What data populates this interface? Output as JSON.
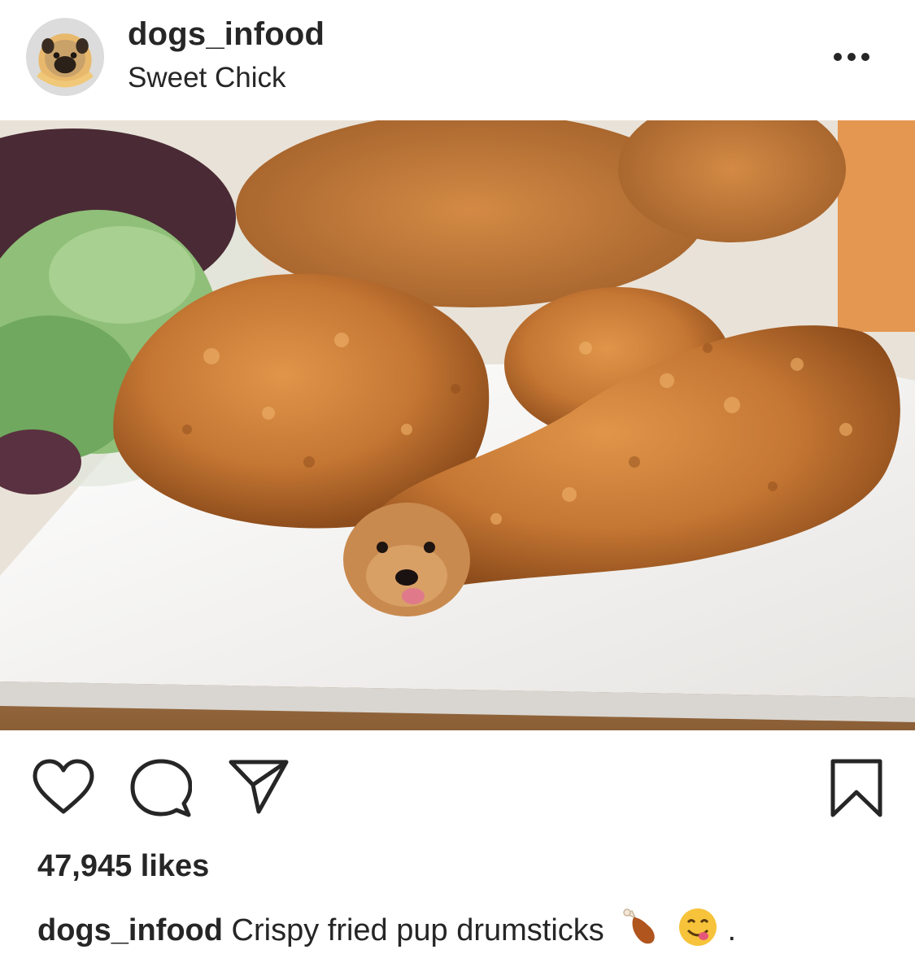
{
  "post": {
    "username": "dogs_infood",
    "location": "Sweet Chick",
    "likes_text": "47,945 likes",
    "caption": {
      "username": "dogs_infood",
      "text": "Crispy fried pup drumsticks",
      "trailing": "."
    }
  },
  "icons": {
    "more": "more-options-icon",
    "like": "heart-icon",
    "comment": "comment-bubble-icon",
    "share": "paper-plane-icon",
    "save": "bookmark-icon",
    "emoji_1": "poultry-leg-emoji",
    "emoji_2": "yum-face-emoji"
  },
  "colors": {
    "text": "#262626",
    "icon": "#262626",
    "chicken": "#c77a36",
    "plate": "#f4f3f1"
  }
}
